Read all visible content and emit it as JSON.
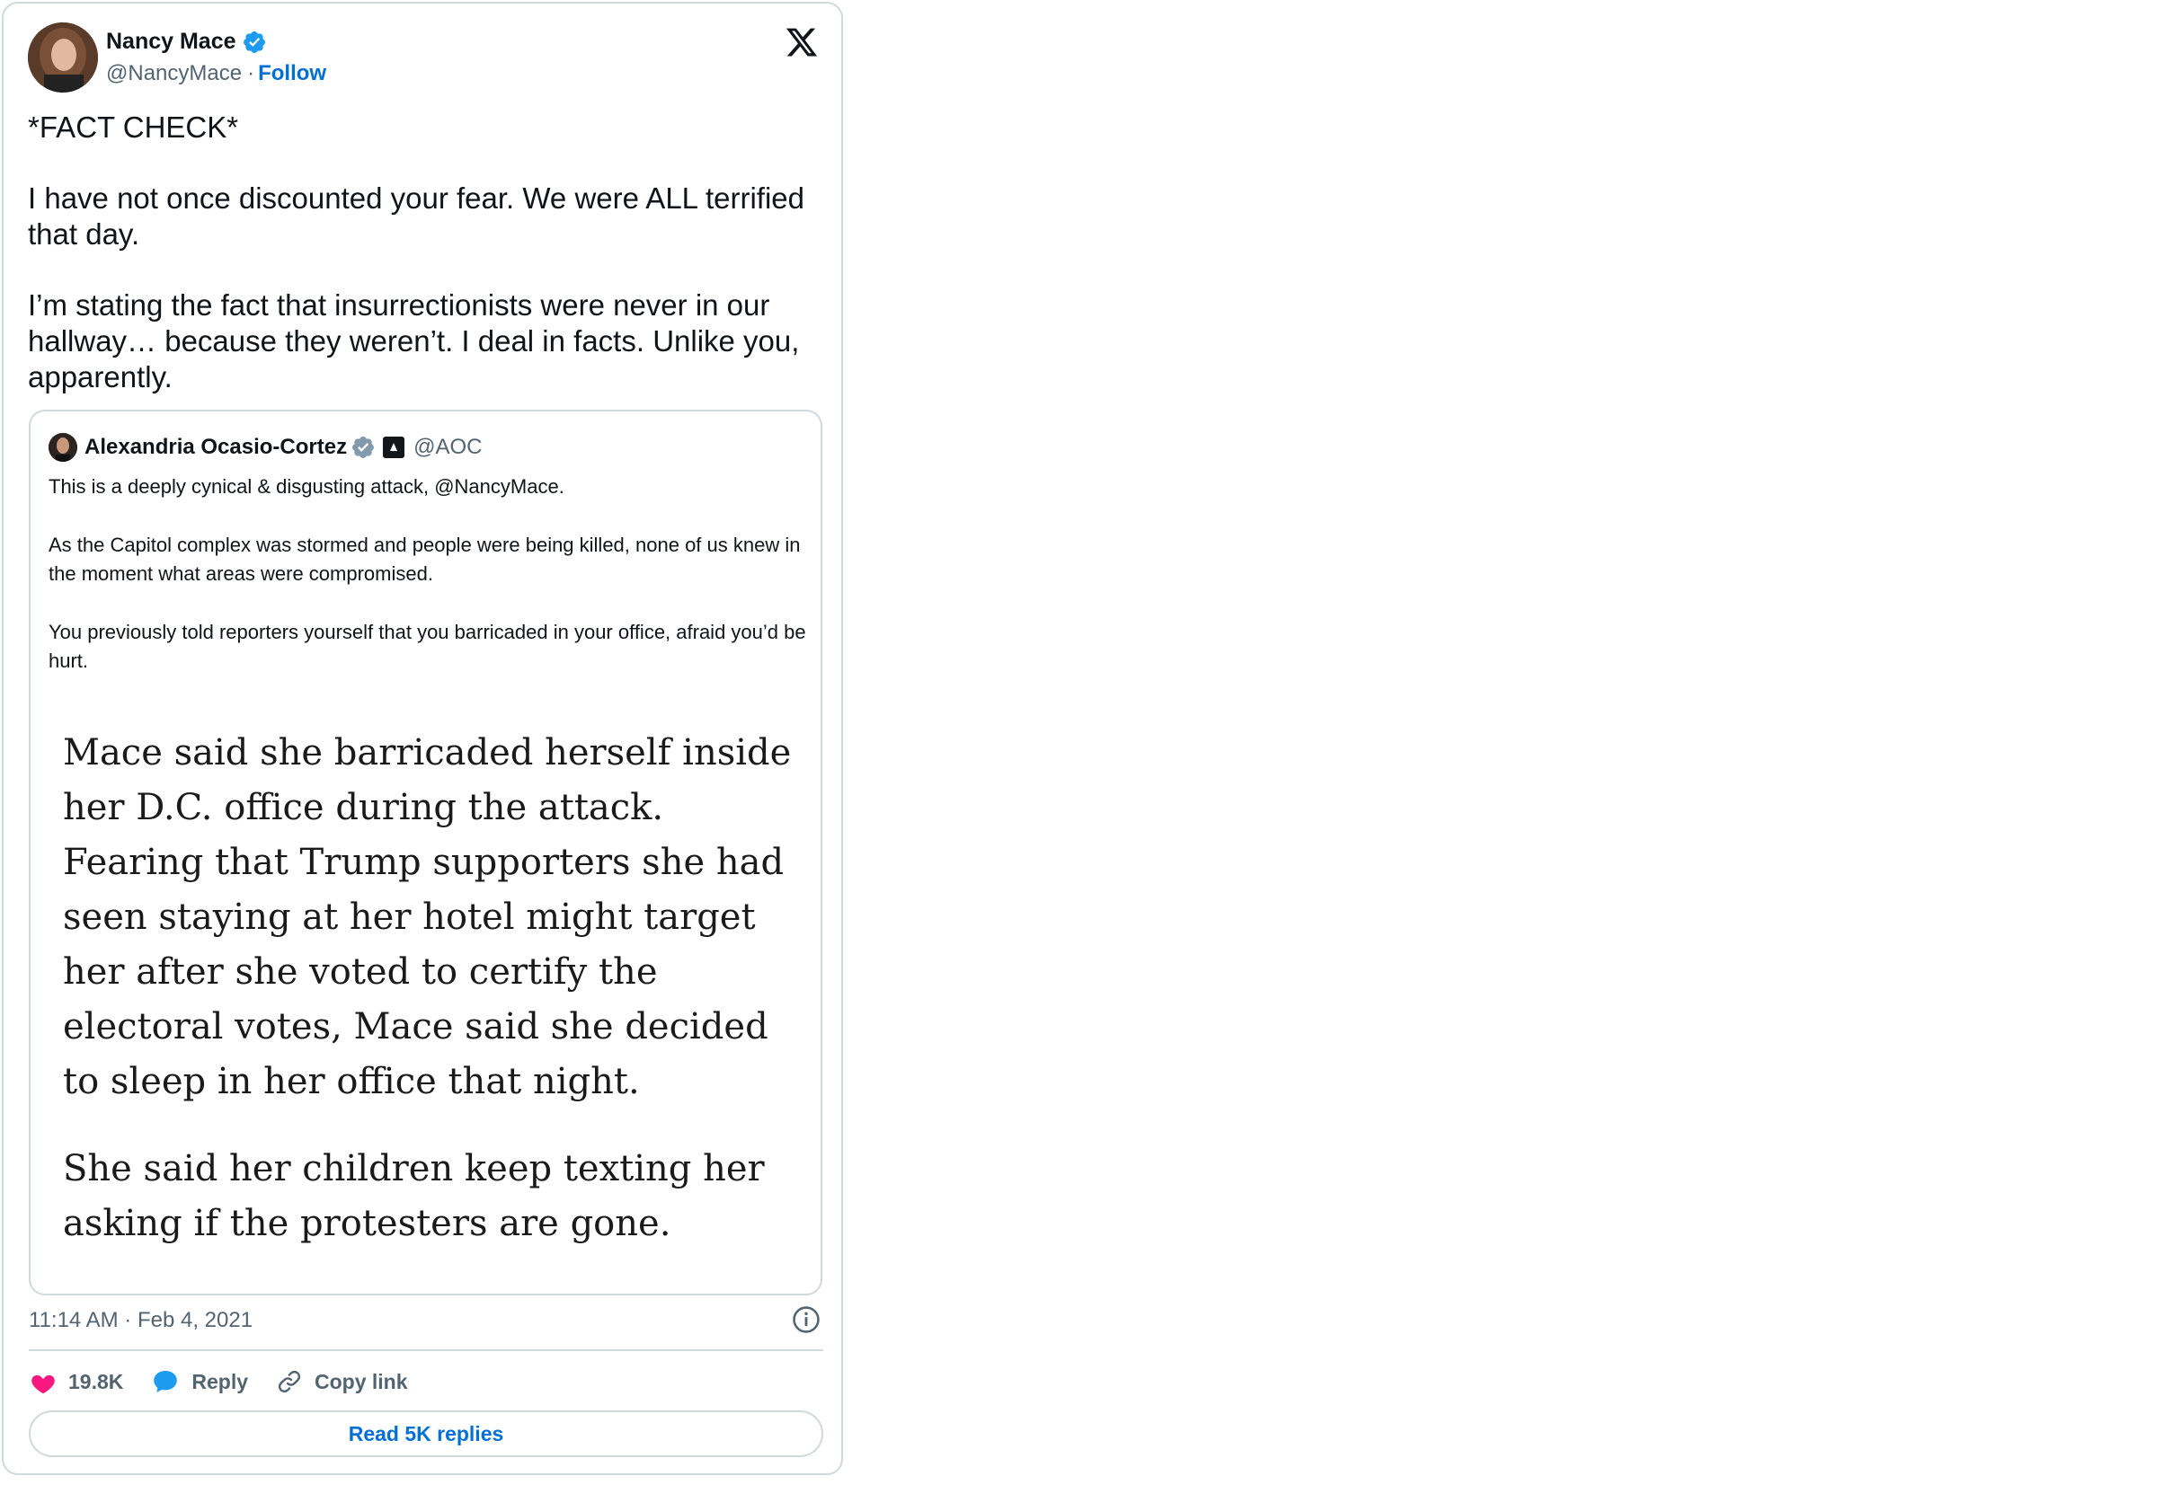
{
  "tweet": {
    "author_name": "Nancy Mace",
    "author_handle": "@NancyMace",
    "separator": "·",
    "follow_label": "Follow",
    "text_lines": [
      "*FACT CHECK*",
      "I have not once discounted your fear. We were ALL terrified that day.",
      "I’m stating the fact that insurrectionists were never in our hallway… because they weren’t. I deal in facts. Unlike you, apparently."
    ],
    "timestamp": "11:14 AM · Feb 4, 2021"
  },
  "quote": {
    "author_name": "Alexandria Ocasio-Cortez",
    "author_handle": "@AOC",
    "text_paragraphs": [
      "This is a deeply cynical & disgusting attack, @NancyMace.",
      "As the Capitol complex was stormed and people were being killed, none of us knew in the moment what areas were compromised.",
      "You previously told reporters yourself that you barricaded in your office, afraid you’d be hurt."
    ],
    "image_paragraphs": [
      "Mace said she barricaded herself inside her D.C. office during the attack. Fearing that Trump supporters she had seen staying at her hotel might target her after she voted to certify the electoral votes, Mace said she decided to sleep in her office that night.",
      "She said her children keep texting her asking if the protesters are gone."
    ]
  },
  "actions": {
    "likes": "19.8K",
    "reply_label": "Reply",
    "copy_link_label": "Copy link",
    "read_replies_label": "Read 5K replies"
  },
  "icons": {
    "heart": "heart-icon",
    "reply": "speech-bubble-icon",
    "link": "link-icon",
    "info": "info-icon",
    "x_logo": "x-logo-icon",
    "verified": "verified-badge-icon"
  },
  "colors": {
    "accent": "#006fd6",
    "verified": "#1d9bf0",
    "heart": "#f91880",
    "reply": "#1d9bf0",
    "muted": "#536471",
    "border": "#cfd9de"
  }
}
